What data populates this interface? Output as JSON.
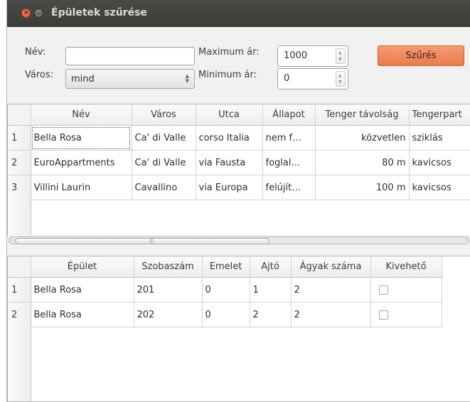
{
  "window": {
    "title": "Épületek szűrése"
  },
  "filter": {
    "name_label": "Név:",
    "name_value": "",
    "city_label": "Város:",
    "city_value": "mind",
    "max_price_label": "Maximum ár:",
    "max_price_value": "1000",
    "min_price_label": "Minimum ár:",
    "min_price_value": "0",
    "filter_button": "Szűrés"
  },
  "buildings": {
    "columns": [
      "Név",
      "Város",
      "Utca",
      "Állapot",
      "Tenger távolság",
      "Tengerpart"
    ],
    "rows": [
      {
        "num": "1",
        "name": "Bella Rosa",
        "city": "Ca' di Valle",
        "street": "corso Italia",
        "state": "nem f…",
        "distance": "közvetlen",
        "beach": "sziklás"
      },
      {
        "num": "2",
        "name": "EuroAppartments",
        "city": "Ca' di Valle",
        "street": "via Fausta",
        "state": "foglal…",
        "distance": "80 m",
        "beach": "kavicsos"
      },
      {
        "num": "3",
        "name": "Villini Laurin",
        "city": "Cavallino",
        "street": "via Europa",
        "state": "felújít…",
        "distance": "100 m",
        "beach": "kavicsos"
      }
    ]
  },
  "rooms": {
    "columns": [
      "Épület",
      "Szobaszám",
      "Emelet",
      "Ajtó",
      "Ágyak száma",
      "Kivehető"
    ],
    "rows": [
      {
        "num": "1",
        "building": "Bella Rosa",
        "room": "201",
        "floor": "0",
        "door": "1",
        "beds": "2",
        "available": false
      },
      {
        "num": "2",
        "building": "Bella Rosa",
        "room": "202",
        "floor": "0",
        "door": "2",
        "beds": "2",
        "available": false
      }
    ]
  },
  "colors": {
    "accent": "#ec7c4c",
    "titlebar": "#3c3b37"
  }
}
